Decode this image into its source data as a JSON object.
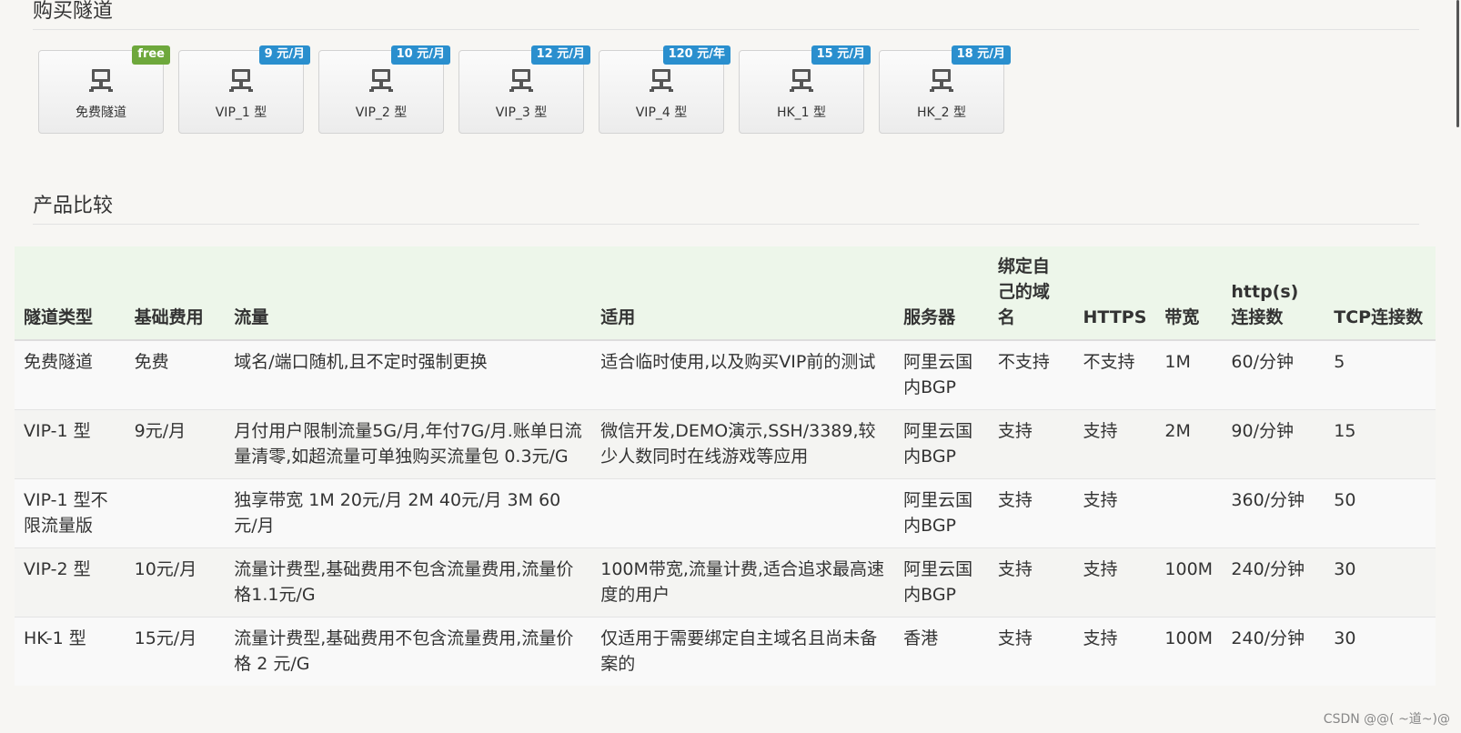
{
  "buy_section": {
    "title": "购买隧道",
    "cards": [
      {
        "label": "免费隧道",
        "badge": "free",
        "badge_color": "#6ea83c"
      },
      {
        "label": "VIP_1 型",
        "badge": "9 元/月",
        "badge_color": "#2a8fce"
      },
      {
        "label": "VIP_2 型",
        "badge": "10 元/月",
        "badge_color": "#2a8fce"
      },
      {
        "label": "VIP_3 型",
        "badge": "12 元/月",
        "badge_color": "#2a8fce"
      },
      {
        "label": "VIP_4 型",
        "badge": "120 元/年",
        "badge_color": "#2a8fce"
      },
      {
        "label": "HK_1 型",
        "badge": "15 元/月",
        "badge_color": "#2a8fce"
      },
      {
        "label": "HK_2 型",
        "badge": "18 元/月",
        "badge_color": "#2a8fce"
      }
    ],
    "card_icon": "network-computer-icon"
  },
  "compare_section": {
    "title": "产品比较",
    "headers": [
      "隧道类型",
      "基础费用",
      "流量",
      "适用",
      "服务器",
      "绑定自己的域名",
      "HTTPS",
      "带宽",
      "http(s)连接数",
      "TCP连接数"
    ],
    "rows": [
      [
        "免费隧道",
        "免费",
        "域名/端口随机,且不定时强制更换",
        "适合临时使用,以及购买VIP前的测试",
        "阿里云国内BGP",
        "不支持",
        "不支持",
        "1M",
        "60/分钟",
        "5"
      ],
      [
        "VIP-1 型",
        "9元/月",
        "月付用户限制流量5G/月,年付7G/月.账单日流量清零,如超流量可单独购买流量包 0.3元/G",
        "微信开发,DEMO演示,SSH/3389,较少人数同时在线游戏等应用",
        "阿里云国内BGP",
        "支持",
        "支持",
        "2M",
        "90/分钟",
        "15"
      ],
      [
        "VIP-1 型不限流量版",
        "",
        "独享带宽 1M 20元/月 2M 40元/月 3M 60元/月",
        "",
        "阿里云国内BGP",
        "支持",
        "支持",
        "",
        "360/分钟",
        "50"
      ],
      [
        "VIP-2 型",
        "10元/月",
        "流量计费型,基础费用不包含流量费用,流量价格1.1元/G",
        "100M带宽,流量计费,适合追求最高速度的用户",
        "阿里云国内BGP",
        "支持",
        "支持",
        "100M",
        "240/分钟",
        "30"
      ],
      [
        "HK-1 型",
        "15元/月",
        "流量计费型,基础费用不包含流量费用,流量价格 2 元/G",
        "仅适用于需要绑定自主域名且尚未备案的",
        "香港",
        "支持",
        "支持",
        "100M",
        "240/分钟",
        "30"
      ]
    ]
  },
  "watermark": "CSDN @@( ~道~)@"
}
